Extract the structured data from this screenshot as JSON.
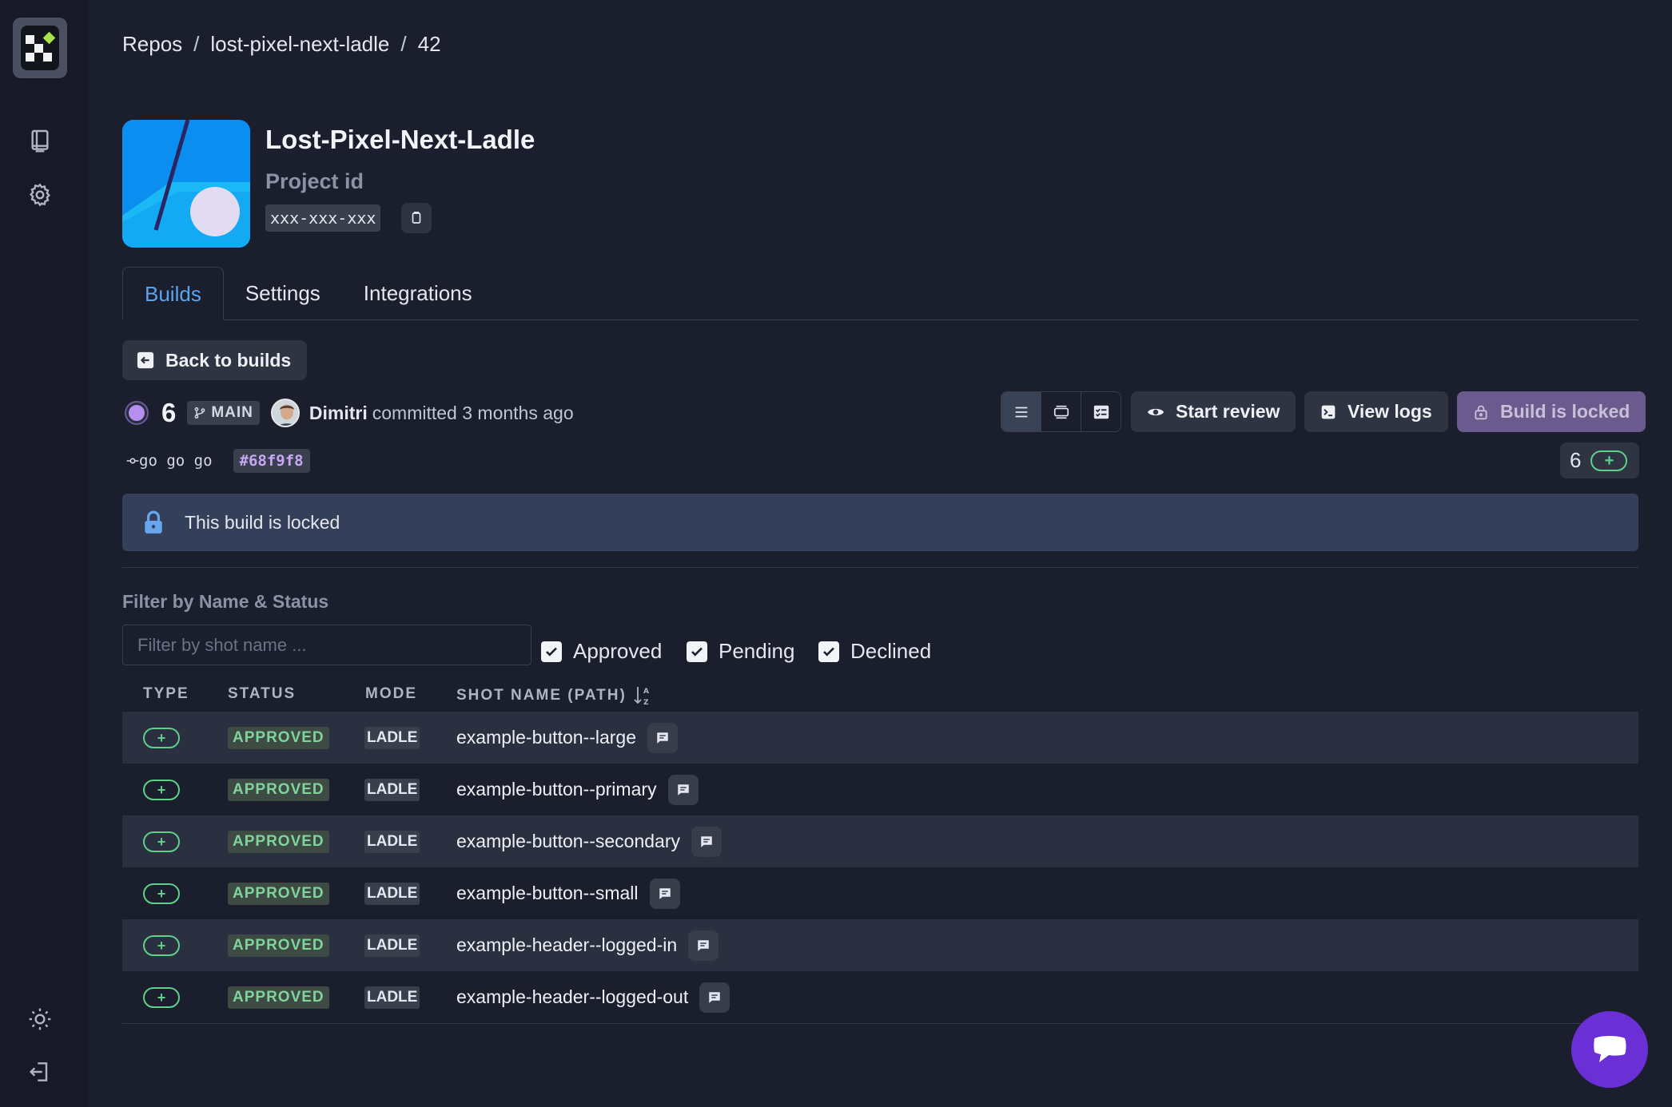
{
  "breadcrumb": {
    "root": "Repos",
    "repo": "lost-pixel-next-ladle",
    "build": "42",
    "separator": "/"
  },
  "project": {
    "title": "Lost-Pixel-Next-Ladle",
    "id_label": "Project id",
    "id_value": "xxx-xxx-xxx"
  },
  "tabs": [
    {
      "label": "Builds",
      "active": true
    },
    {
      "label": "Settings",
      "active": false
    },
    {
      "label": "Integrations",
      "active": false
    }
  ],
  "back_button": "Back to builds",
  "build": {
    "number": "6",
    "branch": "MAIN",
    "committer": "Dimitri",
    "committed_text": "committed 3 months ago",
    "commit_message": "go go go",
    "commit_hash": "#68f9f8"
  },
  "toolbar": {
    "start_review": "Start review",
    "view_logs": "View logs",
    "build_locked": "Build is locked"
  },
  "counts": {
    "added": "6",
    "added_icon": "+"
  },
  "locked_banner": "This build is locked",
  "filter": {
    "label": "Filter by Name & Status",
    "placeholder": "Filter by shot name ...",
    "checkboxes": [
      "Approved",
      "Pending",
      "Declined"
    ]
  },
  "table": {
    "headers": {
      "type": "TYPE",
      "status": "STATUS",
      "mode": "MODE",
      "shot_name": "SHOT NAME (PATH)"
    },
    "rows": [
      {
        "type": "+",
        "status": "APPROVED",
        "mode": "LADLE",
        "name": "example-button--large"
      },
      {
        "type": "+",
        "status": "APPROVED",
        "mode": "LADLE",
        "name": "example-button--primary"
      },
      {
        "type": "+",
        "status": "APPROVED",
        "mode": "LADLE",
        "name": "example-button--secondary"
      },
      {
        "type": "+",
        "status": "APPROVED",
        "mode": "LADLE",
        "name": "example-button--small"
      },
      {
        "type": "+",
        "status": "APPROVED",
        "mode": "LADLE",
        "name": "example-header--logged-in"
      },
      {
        "type": "+",
        "status": "APPROVED",
        "mode": "LADLE",
        "name": "example-header--logged-out"
      }
    ]
  },
  "colors": {
    "background": "#1b1f2d",
    "sidebar": "#171a26",
    "accent": "#5aa4f0",
    "approved": "#7fd49b",
    "locked_button": "#6a5a8e",
    "chat": "#6b2fd6"
  },
  "icons": {
    "sidebar": [
      "book-icon",
      "gear-icon",
      "sun-icon",
      "logout-icon"
    ],
    "chat": "chat-icon"
  }
}
